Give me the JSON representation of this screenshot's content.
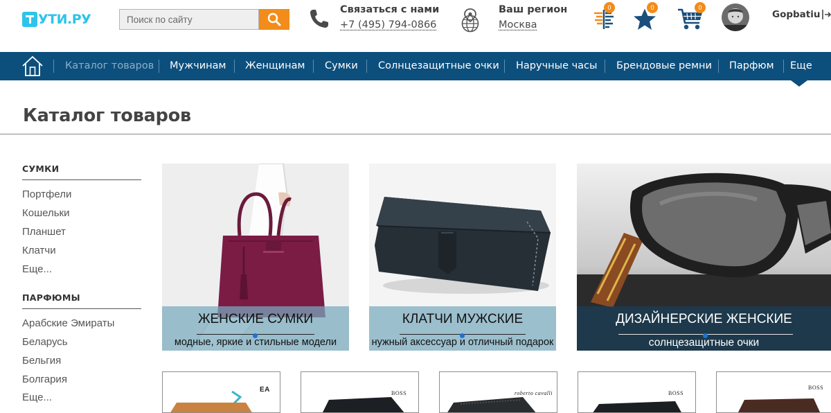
{
  "header": {
    "logo_text": "УТИ.РУ",
    "search_placeholder": "Поиск по сайту",
    "contact_title": "Связаться с нами",
    "contact_phone": "+7 (495) 794-0866",
    "region_title": "Ваш регион",
    "region_city": "Москва",
    "compare_count": "0",
    "favorites_count": "0",
    "cart_count": "0",
    "username": "Gopbatiu",
    "accent_color": "#f28c1a",
    "logo_color": "#2ec4ea"
  },
  "nav": {
    "background": "#0d4f7c",
    "items": [
      {
        "label": "Каталог товаров",
        "active": true
      },
      {
        "label": "Мужчинам"
      },
      {
        "label": "Женщинам"
      },
      {
        "label": "Сумки"
      },
      {
        "label": "Солнцезащитные очки"
      },
      {
        "label": "Наручные часы"
      },
      {
        "label": "Брендовые ремни"
      },
      {
        "label": "Парфюм"
      },
      {
        "label": "Еще"
      }
    ]
  },
  "page": {
    "title": "Каталог товаров"
  },
  "sidebar": {
    "sections": [
      {
        "heading": "СУМКИ",
        "links": [
          "Портфели",
          "Кошельки",
          "Планшет",
          "Клатчи",
          "Еще..."
        ]
      },
      {
        "heading": "ПАРФЮМЫ",
        "links": [
          "Арабские Эмираты",
          "Беларусь",
          "Бельгия",
          "Болгария",
          "Еще..."
        ]
      }
    ]
  },
  "banners": [
    {
      "title": "ЖЕНСКИЕ СУМКИ",
      "subtitle": "модные, яркие и стильные модели"
    },
    {
      "title": "КЛАТЧИ МУЖСКИЕ",
      "subtitle": "нужный аксессуар и отличный подарок"
    },
    {
      "title": "ДИЗАЙНЕРСКИЕ ЖЕНСКИЕ",
      "subtitle": "солнцезащитные очки"
    }
  ],
  "products": [
    {
      "brand": "EA"
    },
    {
      "brand": "BOSS"
    },
    {
      "brand": "roberto cavalli"
    },
    {
      "brand": "BOSS"
    },
    {
      "brand": "BOSS"
    }
  ]
}
